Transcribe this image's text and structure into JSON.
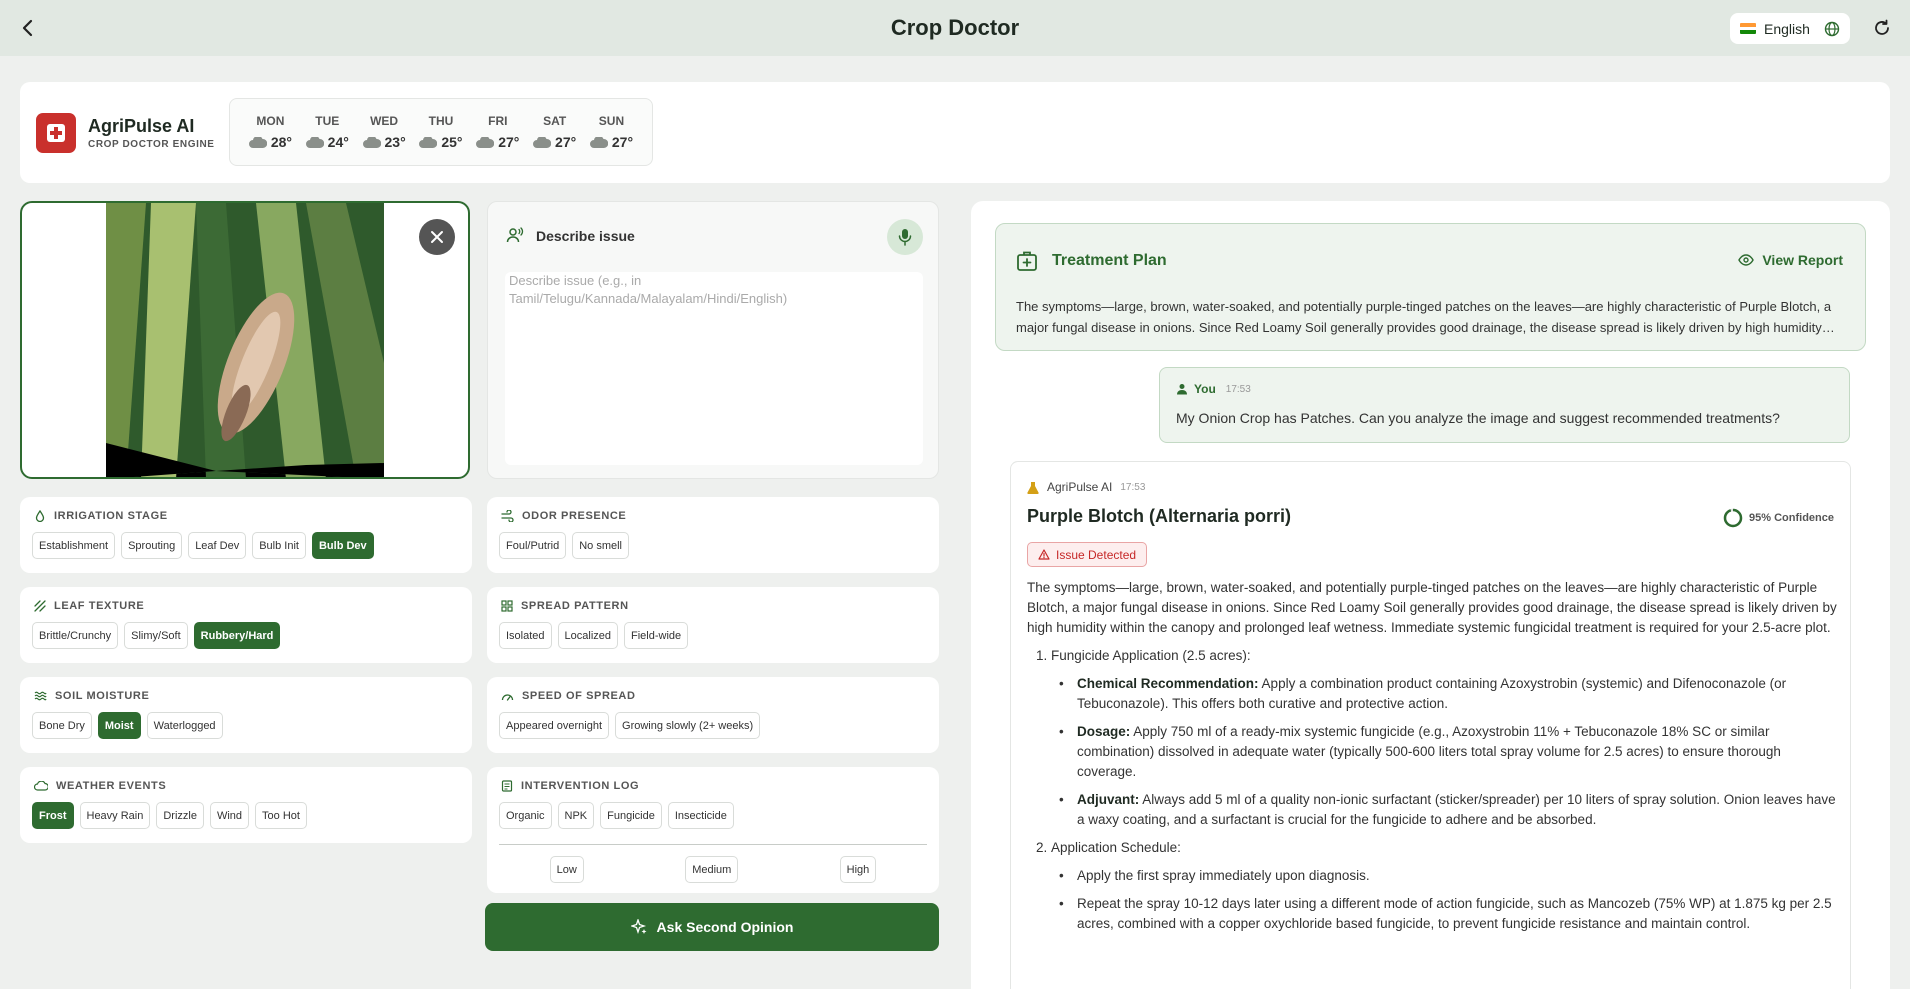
{
  "header": {
    "title": "Crop Doctor",
    "language": "English"
  },
  "brand": {
    "name": "AgriPulse AI",
    "subtitle": "CROP DOCTOR ENGINE"
  },
  "weather": [
    {
      "day": "MON",
      "temp": "28°"
    },
    {
      "day": "TUE",
      "temp": "24°"
    },
    {
      "day": "WED",
      "temp": "23°"
    },
    {
      "day": "THU",
      "temp": "25°"
    },
    {
      "day": "FRI",
      "temp": "27°"
    },
    {
      "day": "SAT",
      "temp": "27°"
    },
    {
      "day": "SUN",
      "temp": "27°"
    }
  ],
  "describe": {
    "title": "Describe issue",
    "placeholder": "Describe issue (e.g., in Tamil/Telugu/Kannada/Malayalam/Hindi/English)",
    "value": ""
  },
  "options": {
    "irrigation": {
      "label": "IRRIGATION STAGE",
      "chips": [
        "Establishment",
        "Sprouting",
        "Leaf Dev",
        "Bulb Init",
        "Bulb Dev"
      ],
      "selected": "Bulb Dev"
    },
    "odor": {
      "label": "ODOR PRESENCE",
      "chips": [
        "Foul/Putrid",
        "No smell"
      ],
      "selected": ""
    },
    "texture": {
      "label": "LEAF TEXTURE",
      "chips": [
        "Brittle/Crunchy",
        "Slimy/Soft",
        "Rubbery/Hard"
      ],
      "selected": "Rubbery/Hard"
    },
    "spread": {
      "label": "SPREAD PATTERN",
      "chips": [
        "Isolated",
        "Localized",
        "Field-wide"
      ],
      "selected": ""
    },
    "moisture": {
      "label": "SOIL MOISTURE",
      "chips": [
        "Bone Dry",
        "Moist",
        "Waterlogged"
      ],
      "selected": "Moist"
    },
    "speed": {
      "label": "SPEED OF SPREAD",
      "chips": [
        "Appeared overnight",
        "Growing slowly (2+ weeks)"
      ],
      "selected": ""
    },
    "weather_events": {
      "label": "WEATHER EVENTS",
      "chips": [
        "Frost",
        "Heavy Rain",
        "Drizzle",
        "Wind",
        "Too Hot"
      ],
      "selected": "Frost"
    },
    "intervention": {
      "label": "INTERVENTION LOG",
      "chips": [
        "Organic",
        "NPK",
        "Fungicide",
        "Insecticide"
      ],
      "selected": "",
      "levels": [
        "Low",
        "Medium",
        "High"
      ]
    }
  },
  "ask_button": "Ask Second Opinion",
  "treatment": {
    "title": "Treatment Plan",
    "view_report": "View Report",
    "summary": "The symptoms—large, brown, water-soaked, and potentially purple-tinged patches on the leaves—are highly characteristic of Purple Blotch, a major fungal disease in onions. Since Red Loamy Soil generally provides good drainage, the disease spread is likely driven by high humidity within the canopy and prolonged leaf wetness."
  },
  "user_message": {
    "sender": "You",
    "time": "17:53",
    "text": "My Onion Crop has Patches. Can you analyze the image and suggest recommended treatments?"
  },
  "ai_message": {
    "sender": "AgriPulse AI",
    "time": "17:53",
    "diagnosis": "Purple Blotch (Alternaria porri)",
    "confidence": "95% Confidence",
    "badge": "Issue Detected",
    "intro": "The symptoms—large, brown, water-soaked, and potentially purple-tinged patches on the leaves—are highly characteristic of Purple Blotch, a major fungal disease in onions. Since Red Loamy Soil generally provides good drainage, the disease spread is likely driven by high humidity within the canopy and prolonged leaf wetness. Immediate systemic fungicidal treatment is required for your 2.5-acre plot.",
    "section1": "Fungicide Application (2.5 acres):",
    "s1_items": [
      {
        "label": "Chemical Recommendation:",
        "text": " Apply a combination product containing Azoxystrobin (systemic) and Difenoconazole (or Tebuconazole). This offers both curative and protective action."
      },
      {
        "label": "Dosage:",
        "text": " Apply 750 ml of a ready-mix systemic fungicide (e.g., Azoxystrobin 11% + Tebuconazole 18% SC or similar combination) dissolved in adequate water (typically 500-600 liters total spray volume for 2.5 acres) to ensure thorough coverage."
      },
      {
        "label": "Adjuvant:",
        "text": " Always add 5 ml of a quality non-ionic surfactant (sticker/spreader) per 10 liters of spray solution. Onion leaves have a waxy coating, and a surfactant is crucial for the fungicide to adhere and be absorbed."
      }
    ],
    "section2": "Application Schedule:",
    "s2_items": [
      "Apply the first spray immediately upon diagnosis.",
      "Repeat the spray 10-12 days later using a different mode of action fungicide, such as Mancozeb (75% WP) at 1.875 kg per 2.5 acres, combined with a copper oxychloride based fungicide, to prevent fungicide resistance and maintain control."
    ]
  },
  "colors": {
    "primary": "#2e6b30",
    "danger": "#c62828",
    "brand_red": "#c9302c"
  }
}
